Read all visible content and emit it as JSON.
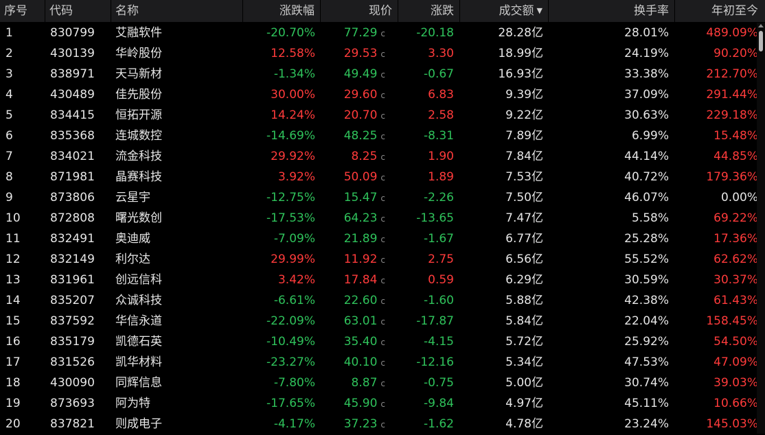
{
  "colors": {
    "up": "#ff3b3b",
    "down": "#2fc25b",
    "header_bg": "#1c1c1e",
    "bg": "#000000"
  },
  "header": {
    "idx": "序号",
    "code": "代码",
    "name": "名称",
    "pct": "涨跌幅",
    "price": "现价",
    "chg": "涨跌",
    "vol": "成交额",
    "vol_sort_icon": "sort-desc-icon",
    "turn": "换手率",
    "ytd": "年初至今"
  },
  "rows": [
    {
      "idx": "1",
      "code": "830799",
      "name": "艾融软件",
      "pct": "-20.70%",
      "price": "77.29",
      "flag": "c",
      "chg": "-20.18",
      "vol": "28.28亿",
      "turn": "28.01%",
      "ytd": "489.09%",
      "dir": "down",
      "ytd_dir": "up"
    },
    {
      "idx": "2",
      "code": "430139",
      "name": "华岭股份",
      "pct": "12.58%",
      "price": "29.53",
      "flag": "c",
      "chg": "3.30",
      "vol": "18.99亿",
      "turn": "24.19%",
      "ytd": "90.20%",
      "dir": "up",
      "ytd_dir": "up"
    },
    {
      "idx": "3",
      "code": "838971",
      "name": "天马新材",
      "pct": "-1.34%",
      "price": "49.49",
      "flag": "c",
      "chg": "-0.67",
      "vol": "16.93亿",
      "turn": "33.38%",
      "ytd": "212.70%",
      "dir": "down",
      "ytd_dir": "up"
    },
    {
      "idx": "4",
      "code": "430489",
      "name": "佳先股份",
      "pct": "30.00%",
      "price": "29.60",
      "flag": "c",
      "chg": "6.83",
      "vol": "9.39亿",
      "turn": "37.09%",
      "ytd": "291.44%",
      "dir": "up",
      "ytd_dir": "up"
    },
    {
      "idx": "5",
      "code": "834415",
      "name": "恒拓开源",
      "pct": "14.24%",
      "price": "20.70",
      "flag": "c",
      "chg": "2.58",
      "vol": "9.22亿",
      "turn": "30.63%",
      "ytd": "229.18%",
      "dir": "up",
      "ytd_dir": "up"
    },
    {
      "idx": "6",
      "code": "835368",
      "name": "连城数控",
      "pct": "-14.69%",
      "price": "48.25",
      "flag": "c",
      "chg": "-8.31",
      "vol": "7.89亿",
      "turn": "6.99%",
      "ytd": "15.48%",
      "dir": "down",
      "ytd_dir": "up"
    },
    {
      "idx": "7",
      "code": "834021",
      "name": "流金科技",
      "pct": "29.92%",
      "price": "8.25",
      "flag": "c",
      "chg": "1.90",
      "vol": "7.84亿",
      "turn": "44.14%",
      "ytd": "44.85%",
      "dir": "up",
      "ytd_dir": "up"
    },
    {
      "idx": "8",
      "code": "871981",
      "name": "晶赛科技",
      "pct": "3.92%",
      "price": "50.09",
      "flag": "c",
      "chg": "1.89",
      "vol": "7.53亿",
      "turn": "40.72%",
      "ytd": "179.36%",
      "dir": "up",
      "ytd_dir": "up"
    },
    {
      "idx": "9",
      "code": "873806",
      "name": "云星宇",
      "pct": "-12.75%",
      "price": "15.47",
      "flag": "c",
      "chg": "-2.26",
      "vol": "7.50亿",
      "turn": "46.07%",
      "ytd": "0.00%",
      "dir": "down",
      "ytd_dir": "flat"
    },
    {
      "idx": "10",
      "code": "872808",
      "name": "曙光数创",
      "pct": "-17.53%",
      "price": "64.23",
      "flag": "c",
      "chg": "-13.65",
      "vol": "7.47亿",
      "turn": "5.58%",
      "ytd": "69.22%",
      "dir": "down",
      "ytd_dir": "up"
    },
    {
      "idx": "11",
      "code": "832491",
      "name": "奥迪威",
      "pct": "-7.09%",
      "price": "21.89",
      "flag": "c",
      "chg": "-1.67",
      "vol": "6.77亿",
      "turn": "25.28%",
      "ytd": "17.36%",
      "dir": "down",
      "ytd_dir": "up"
    },
    {
      "idx": "12",
      "code": "832149",
      "name": "利尔达",
      "pct": "29.99%",
      "price": "11.92",
      "flag": "c",
      "chg": "2.75",
      "vol": "6.56亿",
      "turn": "55.52%",
      "ytd": "62.62%",
      "dir": "up",
      "ytd_dir": "up"
    },
    {
      "idx": "13",
      "code": "831961",
      "name": "创远信科",
      "pct": "3.42%",
      "price": "17.84",
      "flag": "c",
      "chg": "0.59",
      "vol": "6.29亿",
      "turn": "30.59%",
      "ytd": "30.37%",
      "dir": "up",
      "ytd_dir": "up"
    },
    {
      "idx": "14",
      "code": "835207",
      "name": "众诚科技",
      "pct": "-6.61%",
      "price": "22.60",
      "flag": "c",
      "chg": "-1.60",
      "vol": "5.88亿",
      "turn": "42.38%",
      "ytd": "61.43%",
      "dir": "down",
      "ytd_dir": "up"
    },
    {
      "idx": "15",
      "code": "837592",
      "name": "华信永道",
      "pct": "-22.09%",
      "price": "63.01",
      "flag": "c",
      "chg": "-17.87",
      "vol": "5.84亿",
      "turn": "22.04%",
      "ytd": "158.45%",
      "dir": "down",
      "ytd_dir": "up"
    },
    {
      "idx": "16",
      "code": "835179",
      "name": "凯德石英",
      "pct": "-10.49%",
      "price": "35.40",
      "flag": "c",
      "chg": "-4.15",
      "vol": "5.72亿",
      "turn": "25.92%",
      "ytd": "54.50%",
      "dir": "down",
      "ytd_dir": "up"
    },
    {
      "idx": "17",
      "code": "831526",
      "name": "凯华材料",
      "pct": "-23.27%",
      "price": "40.10",
      "flag": "c",
      "chg": "-12.16",
      "vol": "5.34亿",
      "turn": "47.53%",
      "ytd": "47.09%",
      "dir": "down",
      "ytd_dir": "up"
    },
    {
      "idx": "18",
      "code": "430090",
      "name": "同辉信息",
      "pct": "-7.80%",
      "price": "8.87",
      "flag": "c",
      "chg": "-0.75",
      "vol": "5.00亿",
      "turn": "30.74%",
      "ytd": "39.03%",
      "dir": "down",
      "ytd_dir": "up"
    },
    {
      "idx": "19",
      "code": "873693",
      "name": "阿为特",
      "pct": "-17.65%",
      "price": "45.90",
      "flag": "c",
      "chg": "-9.84",
      "vol": "4.97亿",
      "turn": "45.11%",
      "ytd": "10.66%",
      "dir": "down",
      "ytd_dir": "up"
    },
    {
      "idx": "20",
      "code": "837821",
      "name": "则成电子",
      "pct": "-4.17%",
      "price": "37.23",
      "flag": "c",
      "chg": "-1.62",
      "vol": "4.78亿",
      "turn": "23.24%",
      "ytd": "145.03%",
      "dir": "down",
      "ytd_dir": "up"
    }
  ]
}
